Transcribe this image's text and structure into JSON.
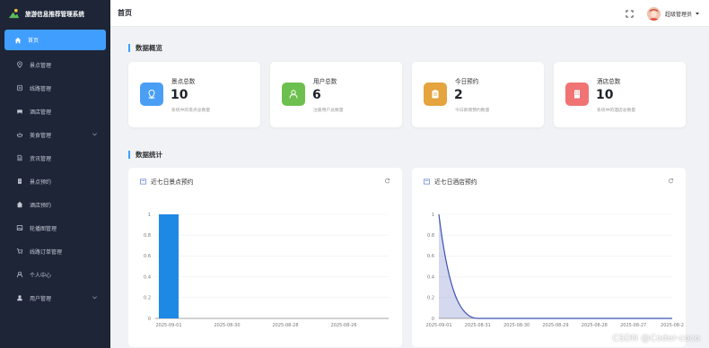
{
  "app": {
    "title": "旅游信息推荐管理系统"
  },
  "sidebar": {
    "items": [
      {
        "label": "首页",
        "icon": "home-icon"
      },
      {
        "label": "景点管理",
        "icon": "location-icon"
      },
      {
        "label": "线路管理",
        "icon": "route-icon"
      },
      {
        "label": "酒店管理",
        "icon": "hotel-icon"
      },
      {
        "label": "美食管理",
        "icon": "food-icon"
      },
      {
        "label": "资讯管理",
        "icon": "document-icon"
      },
      {
        "label": "景点预约",
        "icon": "building-icon"
      },
      {
        "label": "酒店预约",
        "icon": "home-icon"
      },
      {
        "label": "轮播图管理",
        "icon": "picture-icon"
      },
      {
        "label": "线路订单管理",
        "icon": "cart-icon"
      },
      {
        "label": "个人中心",
        "icon": "user-icon"
      },
      {
        "label": "用户管理",
        "icon": "user-filled-icon"
      }
    ]
  },
  "header": {
    "title": "首页",
    "user_name": "超级管理员"
  },
  "overview": {
    "title": "数据概览"
  },
  "cards": [
    {
      "label": "景点总数",
      "value": "10",
      "sub": "系统中的景点总数量",
      "color": "#4a9ff5"
    },
    {
      "label": "用户总数",
      "value": "6",
      "sub": "注册用户总数量",
      "color": "#6dc04f"
    },
    {
      "label": "今日预约",
      "value": "2",
      "sub": "今日新增预约数量",
      "color": "#e5a43e"
    },
    {
      "label": "酒店总数",
      "value": "10",
      "sub": "系统中的酒店总数量",
      "color": "#f07474"
    }
  ],
  "stats": {
    "title": "数据统计"
  },
  "chart_data": [
    {
      "type": "bar",
      "title": "近七日景点预约",
      "categories": [
        "2025-09-01",
        "2025-08-30",
        "2025-08-28",
        "2025-08-26"
      ],
      "values": [
        1,
        0,
        0,
        0
      ],
      "ylim": [
        0,
        1
      ],
      "yticks": [
        "0",
        "0.2",
        "0.4",
        "0.6",
        "0.8",
        "1"
      ],
      "grid": true,
      "color": "#1e88e5"
    },
    {
      "type": "area",
      "title": "近七日酒店预约",
      "categories": [
        "2025-09-01",
        "2025-08-31",
        "2025-08-30",
        "2025-08-29",
        "2025-08-28",
        "2025-08-27",
        "2025-08-2"
      ],
      "values": [
        1,
        0,
        0,
        0,
        0,
        0,
        0
      ],
      "ylim": [
        0,
        1
      ],
      "yticks": [
        "0",
        "0.2",
        "0.4",
        "0.6",
        "0.8",
        "1"
      ],
      "grid": true,
      "color": "#3f51b5"
    }
  ],
  "watermark": "CSDN @Coder-coco"
}
